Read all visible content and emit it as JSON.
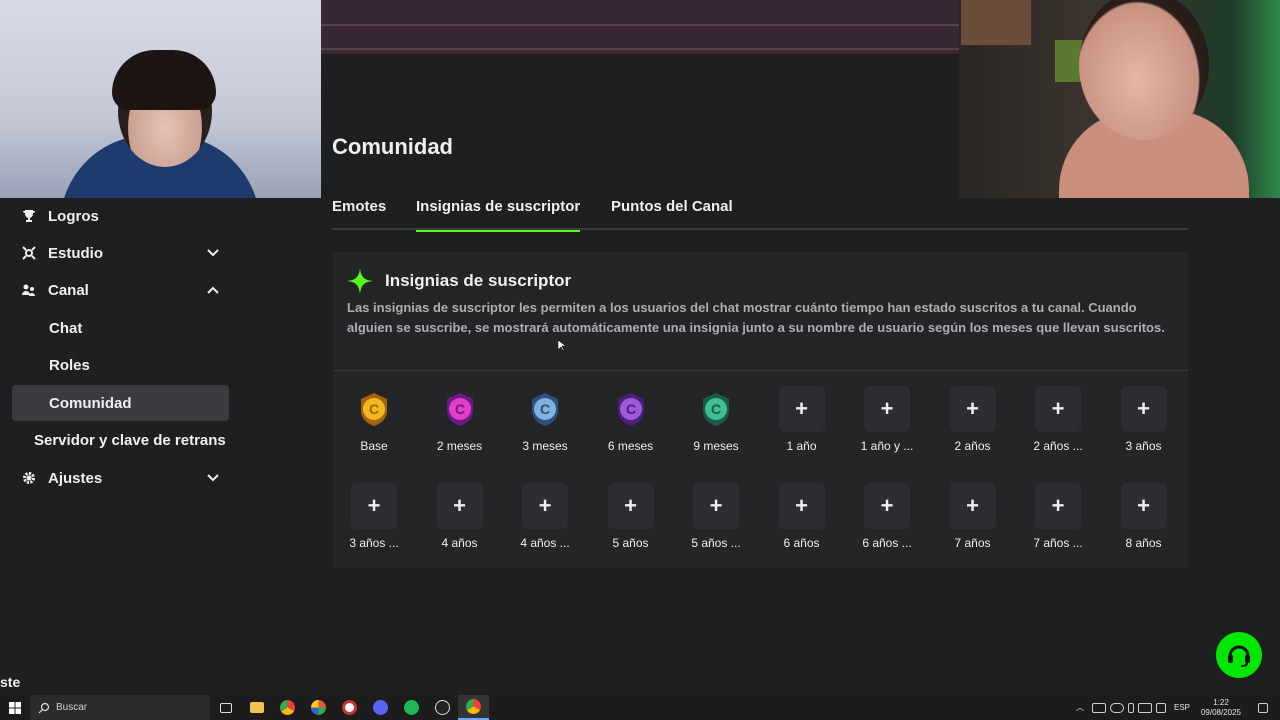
{
  "sidebar": {
    "items": [
      {
        "label": "Logros",
        "icon": "trophy-icon"
      },
      {
        "label": "Estudio",
        "icon": "studio-icon"
      },
      {
        "label": "Canal",
        "icon": "users-icon"
      },
      {
        "label": "Chat"
      },
      {
        "label": "Roles"
      },
      {
        "label": "Comunidad"
      },
      {
        "label": "Servidor y clave de retrans"
      },
      {
        "label": "Ajustes",
        "icon": "gear-icon"
      }
    ]
  },
  "main": {
    "title": "Comunidad",
    "tabs": [
      {
        "label": "Emotes"
      },
      {
        "label": "Insignias de suscriptor"
      },
      {
        "label": "Puntos del Canal"
      }
    ],
    "card": {
      "title": "Insignias de suscriptor",
      "description": "Las insignias de suscriptor les permiten a los usuarios del chat mostrar cuánto tiempo han estado suscritos a tu canal. Cuando alguien se suscribe, se mostrará automáticamente una insignia junto a su nombre de usuario según los meses que llevan suscritos."
    },
    "badges": [
      {
        "label": "Base",
        "icon": "gold-c-badge-icon"
      },
      {
        "label": "2 meses",
        "icon": "pink-c-badge-icon"
      },
      {
        "label": "3 meses",
        "icon": "blue-c-badge-icon"
      },
      {
        "label": "6 meses",
        "icon": "purple-c-badge-icon"
      },
      {
        "label": "9 meses",
        "icon": "green-c-badge-icon"
      },
      {
        "label": "1 año"
      },
      {
        "label": "1 año y ..."
      },
      {
        "label": "2 años"
      },
      {
        "label": "2 años ..."
      },
      {
        "label": "3 años"
      },
      {
        "label": "3 años ..."
      },
      {
        "label": "4 años"
      },
      {
        "label": "4 años ..."
      },
      {
        "label": "5 años"
      },
      {
        "label": "5 años ..."
      },
      {
        "label": "6 años"
      },
      {
        "label": "6 años ..."
      },
      {
        "label": "7 años"
      },
      {
        "label": "7 años ..."
      },
      {
        "label": "8 años"
      }
    ],
    "plus_symbol": "+"
  },
  "overlay": {
    "text": "ste"
  },
  "taskbar": {
    "search_placeholder": "Buscar",
    "lang": "ESP",
    "time": "1:22",
    "date": "09/08/2025"
  },
  "colors": {
    "accent": "#53fc18",
    "support": "#00e701"
  }
}
